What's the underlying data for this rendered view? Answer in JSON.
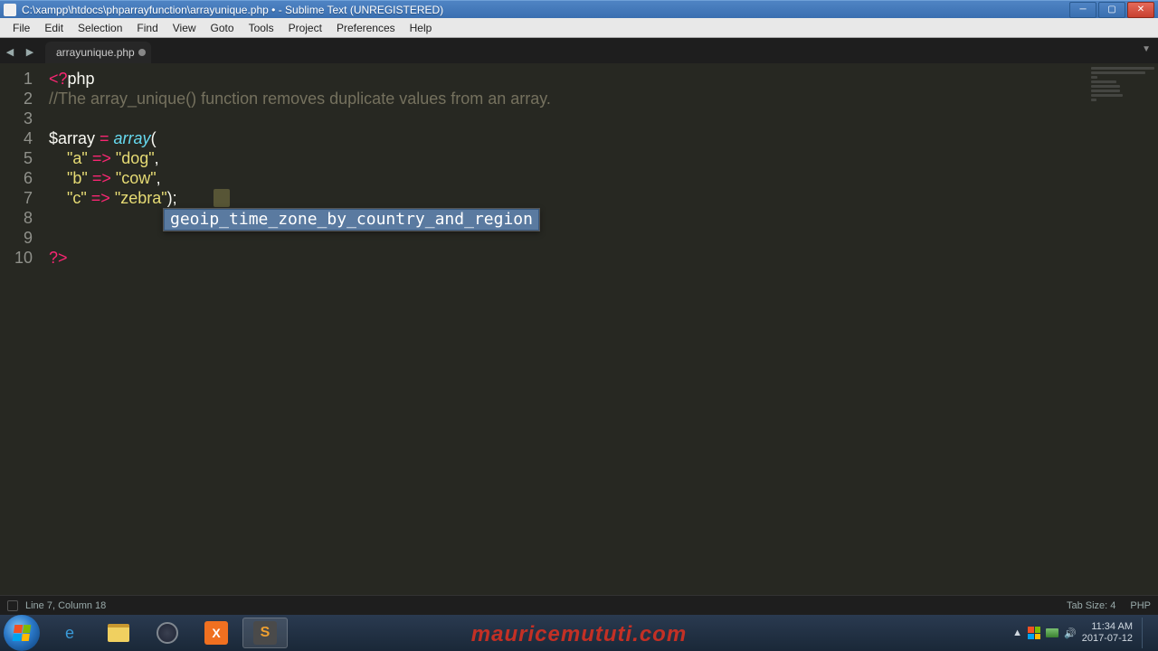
{
  "titlebar": {
    "path": "C:\\xampp\\htdocs\\phparrayfunction\\arrayunique.php • - Sublime Text (UNREGISTERED)"
  },
  "menu": {
    "items": [
      "File",
      "Edit",
      "Selection",
      "Find",
      "View",
      "Goto",
      "Tools",
      "Project",
      "Preferences",
      "Help"
    ]
  },
  "tab": {
    "name": "arrayunique.php",
    "dirty": true
  },
  "gutter": [
    "1",
    "2",
    "3",
    "4",
    "5",
    "6",
    "7",
    "8",
    "9",
    "10"
  ],
  "code": {
    "l1": {
      "open": "<?",
      "php": "php"
    },
    "l2": "//The array_unique() function removes duplicate values from an array.",
    "l4": {
      "var": "$array",
      "eq": " = ",
      "fn": "array",
      "open": "("
    },
    "l5": {
      "pad": "    ",
      "k": "\"a\"",
      "arrow": " => ",
      "v": "\"dog\"",
      "comma": ","
    },
    "l6": {
      "pad": "    ",
      "k": "\"b\"",
      "arrow": " => ",
      "v": "\"cow\"",
      "comma": ","
    },
    "l7": {
      "pad": "    ",
      "k": "\"c\"",
      "arrow": " => ",
      "v": "\"zebra\"",
      "close": ");"
    },
    "l10": "?>"
  },
  "autocomplete": {
    "item": "geoip_time_zone_by_country_and_region"
  },
  "statusbar": {
    "left": "Line 7, Column 18",
    "tab": "Tab Size: 4",
    "lang": "PHP"
  },
  "tray": {
    "time": "11:34 AM",
    "date": "2017-07-12"
  },
  "watermark": "mauricemututi.com"
}
